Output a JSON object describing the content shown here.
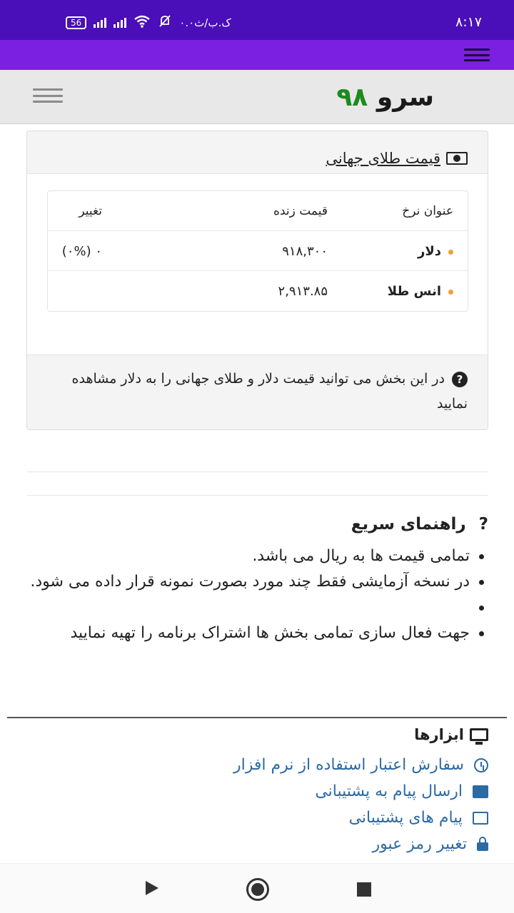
{
  "status_bar": {
    "time": "۸:۱۷",
    "battery": "56",
    "speed": "۰.۰ک.ب/ث"
  },
  "site": {
    "brand_word": "سرو",
    "brand_number": "۹۸"
  },
  "gold_card": {
    "title": "قیمت طلای جهانی",
    "columns": [
      "عنوان نرخ",
      "قیمت زنده",
      "تغییر"
    ],
    "rows": [
      {
        "title": "دلار",
        "price": "۹۱۸,۳۰۰",
        "change": "(۰%) ۰"
      },
      {
        "title": "انس طلا",
        "price": "۲,۹۱۳.۸۵",
        "change": ""
      }
    ],
    "footer_text": "در این بخش می توانید قیمت دلار و طلای جهانی را به دلار مشاهده نمایید"
  },
  "quick_guide": {
    "icon_symbol": "?",
    "title": "راهنمای سریع",
    "items": [
      "تمامی قیمت ها به ریال می باشد.",
      "در نسخه آزمایشی فقط چند مورد بصورت نمونه قرار داده می شود.",
      "",
      "جهت فعال سازی تمامی بخش ها اشتراک برنامه را تهیه نمایید"
    ]
  },
  "tools": {
    "title": "ابزارها",
    "links": [
      {
        "label": "سفارش اعتبار استفاده از نرم افزار",
        "icon": "clock-icon"
      },
      {
        "label": "ارسال پیام به پشتیبانی",
        "icon": "envelope-filled-icon"
      },
      {
        "label": "پیام های پشتیبانی",
        "icon": "envelope-outline-icon"
      },
      {
        "label": "تغییر رمز عبور",
        "icon": "lock-icon"
      }
    ]
  },
  "colors": {
    "status_bar": "#4a0fb8",
    "app_bar": "#7b1fe0",
    "brand_number": "#1e8a1e",
    "link": "#2b6aa3",
    "row_dot": "#f0a030"
  }
}
